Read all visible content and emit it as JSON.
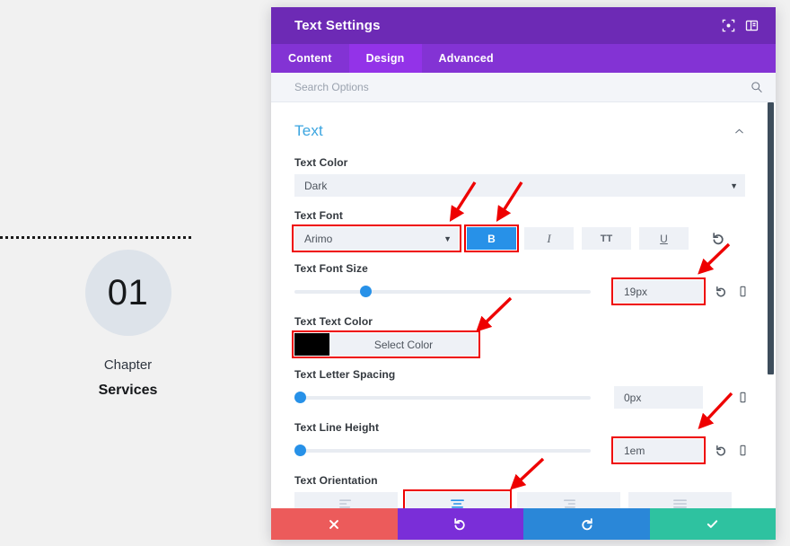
{
  "preview": {
    "chapter_number": "01",
    "chapter_word": "Chapter",
    "chapter_title": "Services",
    "circle_color": "#dde3ea"
  },
  "panel": {
    "title": "Text Settings",
    "header_icons": [
      {
        "name": "focus-icon",
        "label": "focus"
      },
      {
        "name": "layout-icon",
        "label": "layout"
      }
    ],
    "tabs": [
      {
        "label": "Content",
        "active": false
      },
      {
        "label": "Design",
        "active": true
      },
      {
        "label": "Advanced",
        "active": false
      }
    ],
    "search": {
      "placeholder": "Search Options",
      "value": ""
    },
    "accent_color": "#6d2ab5",
    "tab_bar_color": "#8333d4",
    "active_tab_color": "#9333e8"
  },
  "section": {
    "title": "Text",
    "collapsed": false
  },
  "fields": {
    "text_color": {
      "label": "Text Color",
      "value": "Dark"
    },
    "text_font": {
      "label": "Text Font",
      "value": "Arimo",
      "styles": [
        {
          "name": "bold",
          "label": "B",
          "active": true
        },
        {
          "name": "italic",
          "label": "I",
          "active": false
        },
        {
          "name": "uppercase",
          "label": "TT",
          "active": false
        },
        {
          "name": "underline",
          "label": "U",
          "active": false
        }
      ]
    },
    "text_font_size": {
      "label": "Text Font Size",
      "value": "19px",
      "slider_percent": 22
    },
    "text_text_color": {
      "label": "Text Text Color",
      "swatch": "#000000",
      "button_label": "Select Color"
    },
    "text_letter_spacing": {
      "label": "Text Letter Spacing",
      "value": "0px",
      "slider_percent": 0
    },
    "text_line_height": {
      "label": "Text Line Height",
      "value": "1em",
      "slider_percent": 0
    },
    "text_orientation": {
      "label": "Text Orientation",
      "options": [
        {
          "name": "align-left",
          "active": false
        },
        {
          "name": "align-center",
          "active": true
        },
        {
          "name": "align-right",
          "active": false
        },
        {
          "name": "align-justify",
          "active": false
        }
      ]
    }
  },
  "footer": {
    "buttons": [
      {
        "name": "cancel-button",
        "glyph": "✖",
        "color": "#ec5b5b"
      },
      {
        "name": "undo-button",
        "glyph": "↺",
        "color": "#7a2ed8"
      },
      {
        "name": "redo-button",
        "glyph": "↻",
        "color": "#2a87d8"
      },
      {
        "name": "save-button",
        "glyph": "✔",
        "color": "#2ec2a0"
      }
    ]
  },
  "annotations": {
    "color": "#ee0000",
    "count": 6
  }
}
